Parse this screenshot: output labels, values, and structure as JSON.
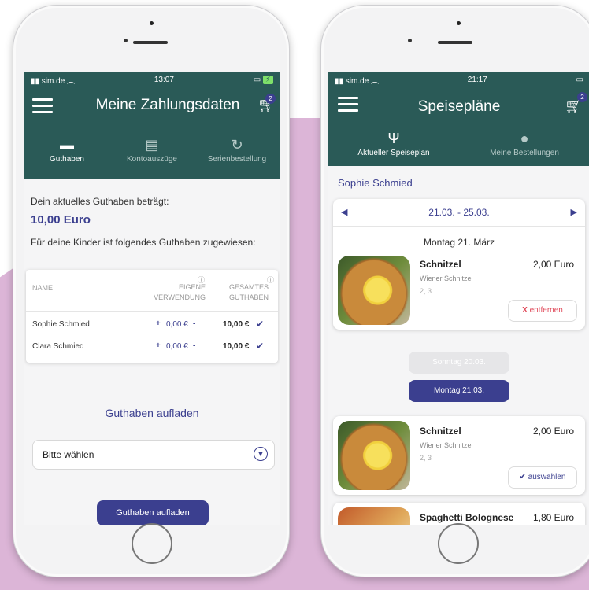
{
  "left_phone": {
    "status": {
      "carrier": "sim.de",
      "time": "13:07"
    },
    "header": {
      "title": "Meine Zahlungsdaten",
      "cart_count": "2"
    },
    "tabs": [
      {
        "label": "Guthaben",
        "icon": "wallet-add-icon"
      },
      {
        "label": "Kontoauszüge",
        "icon": "statement-icon"
      },
      {
        "label": "Serienbestellung",
        "icon": "repeat-icon"
      }
    ],
    "balance_label": "Dein aktuelles Guthaben beträgt:",
    "balance_value": "10,00 Euro",
    "kids_label": "Für deine Kinder ist folgendes Guthaben zugewiesen:",
    "table": {
      "col_name": "NAME",
      "col_own": "EIGENE VERWENDUNG",
      "col_total": "GESAMTES GUTHABEN",
      "rows": [
        {
          "name": "Sophie Schmied",
          "own": "0,00 €",
          "total": "10,00 €"
        },
        {
          "name": "Clara Schmied",
          "own": "0,00 €",
          "total": "10,00 €"
        }
      ]
    },
    "topup_title": "Guthaben aufladen",
    "select_placeholder": "Bitte wählen",
    "topup_button": "Guthaben aufladen"
  },
  "right_phone": {
    "status": {
      "carrier": "sim.de",
      "time": "21:17"
    },
    "header": {
      "title": "Speisepläne",
      "cart_count": "2"
    },
    "tabs": [
      {
        "label": "Aktueller Speiseplan",
        "icon": "cutlery-icon"
      },
      {
        "label": "Meine Bestellungen",
        "icon": "apple-icon"
      }
    ],
    "child_name": "Sophie Schmied",
    "week_range": "21.03. - 25.03.",
    "day_heading": "Montag 21. März",
    "meal1": {
      "name": "Schnitzel",
      "price": "2,00 Euro",
      "desc": "Wiener Schnitzel",
      "allergens": "2, 3",
      "action": "entfernen"
    },
    "day_pill_inactive": "Sonntag 20.03.",
    "day_pill_active": "Montag 21.03.",
    "meal2": {
      "name": "Schnitzel",
      "price": "2,00 Euro",
      "desc": "Wiener Schnitzel",
      "allergens": "2, 3",
      "action": "auswählen"
    },
    "meal3": {
      "name": "Spaghetti Bolognese",
      "price": "1,80 Euro"
    }
  },
  "colors": {
    "header": "#2a5a57",
    "accent": "#3b3f8f",
    "remove": "#e04a5a",
    "background_shape": "#dcb5d7"
  }
}
